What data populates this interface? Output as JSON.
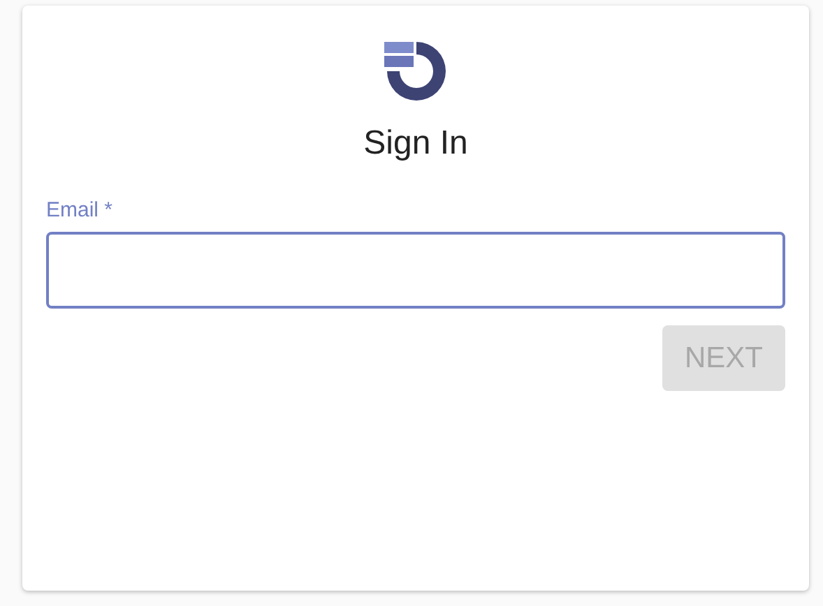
{
  "title": "Sign In",
  "email_field": {
    "label": "Email *",
    "focused": true
  },
  "next_button": {
    "label": "NEXT",
    "disabled": true
  }
}
